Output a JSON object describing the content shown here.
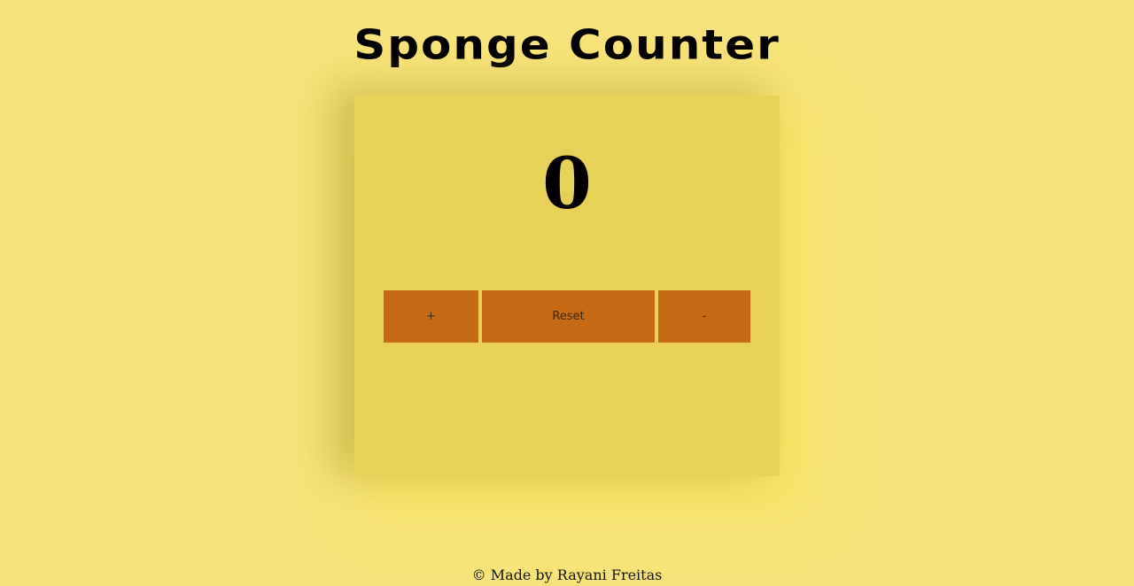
{
  "header": {
    "title": "Sponge Counter"
  },
  "counter": {
    "value": "0"
  },
  "controls": {
    "increment_label": "+",
    "reset_label": "Reset",
    "decrement_label": "-"
  },
  "footer": {
    "credit": "© Made by Rayani Freitas"
  },
  "colors": {
    "background": "#f8e37a",
    "card": "#e9d157",
    "button": "#c66915"
  }
}
